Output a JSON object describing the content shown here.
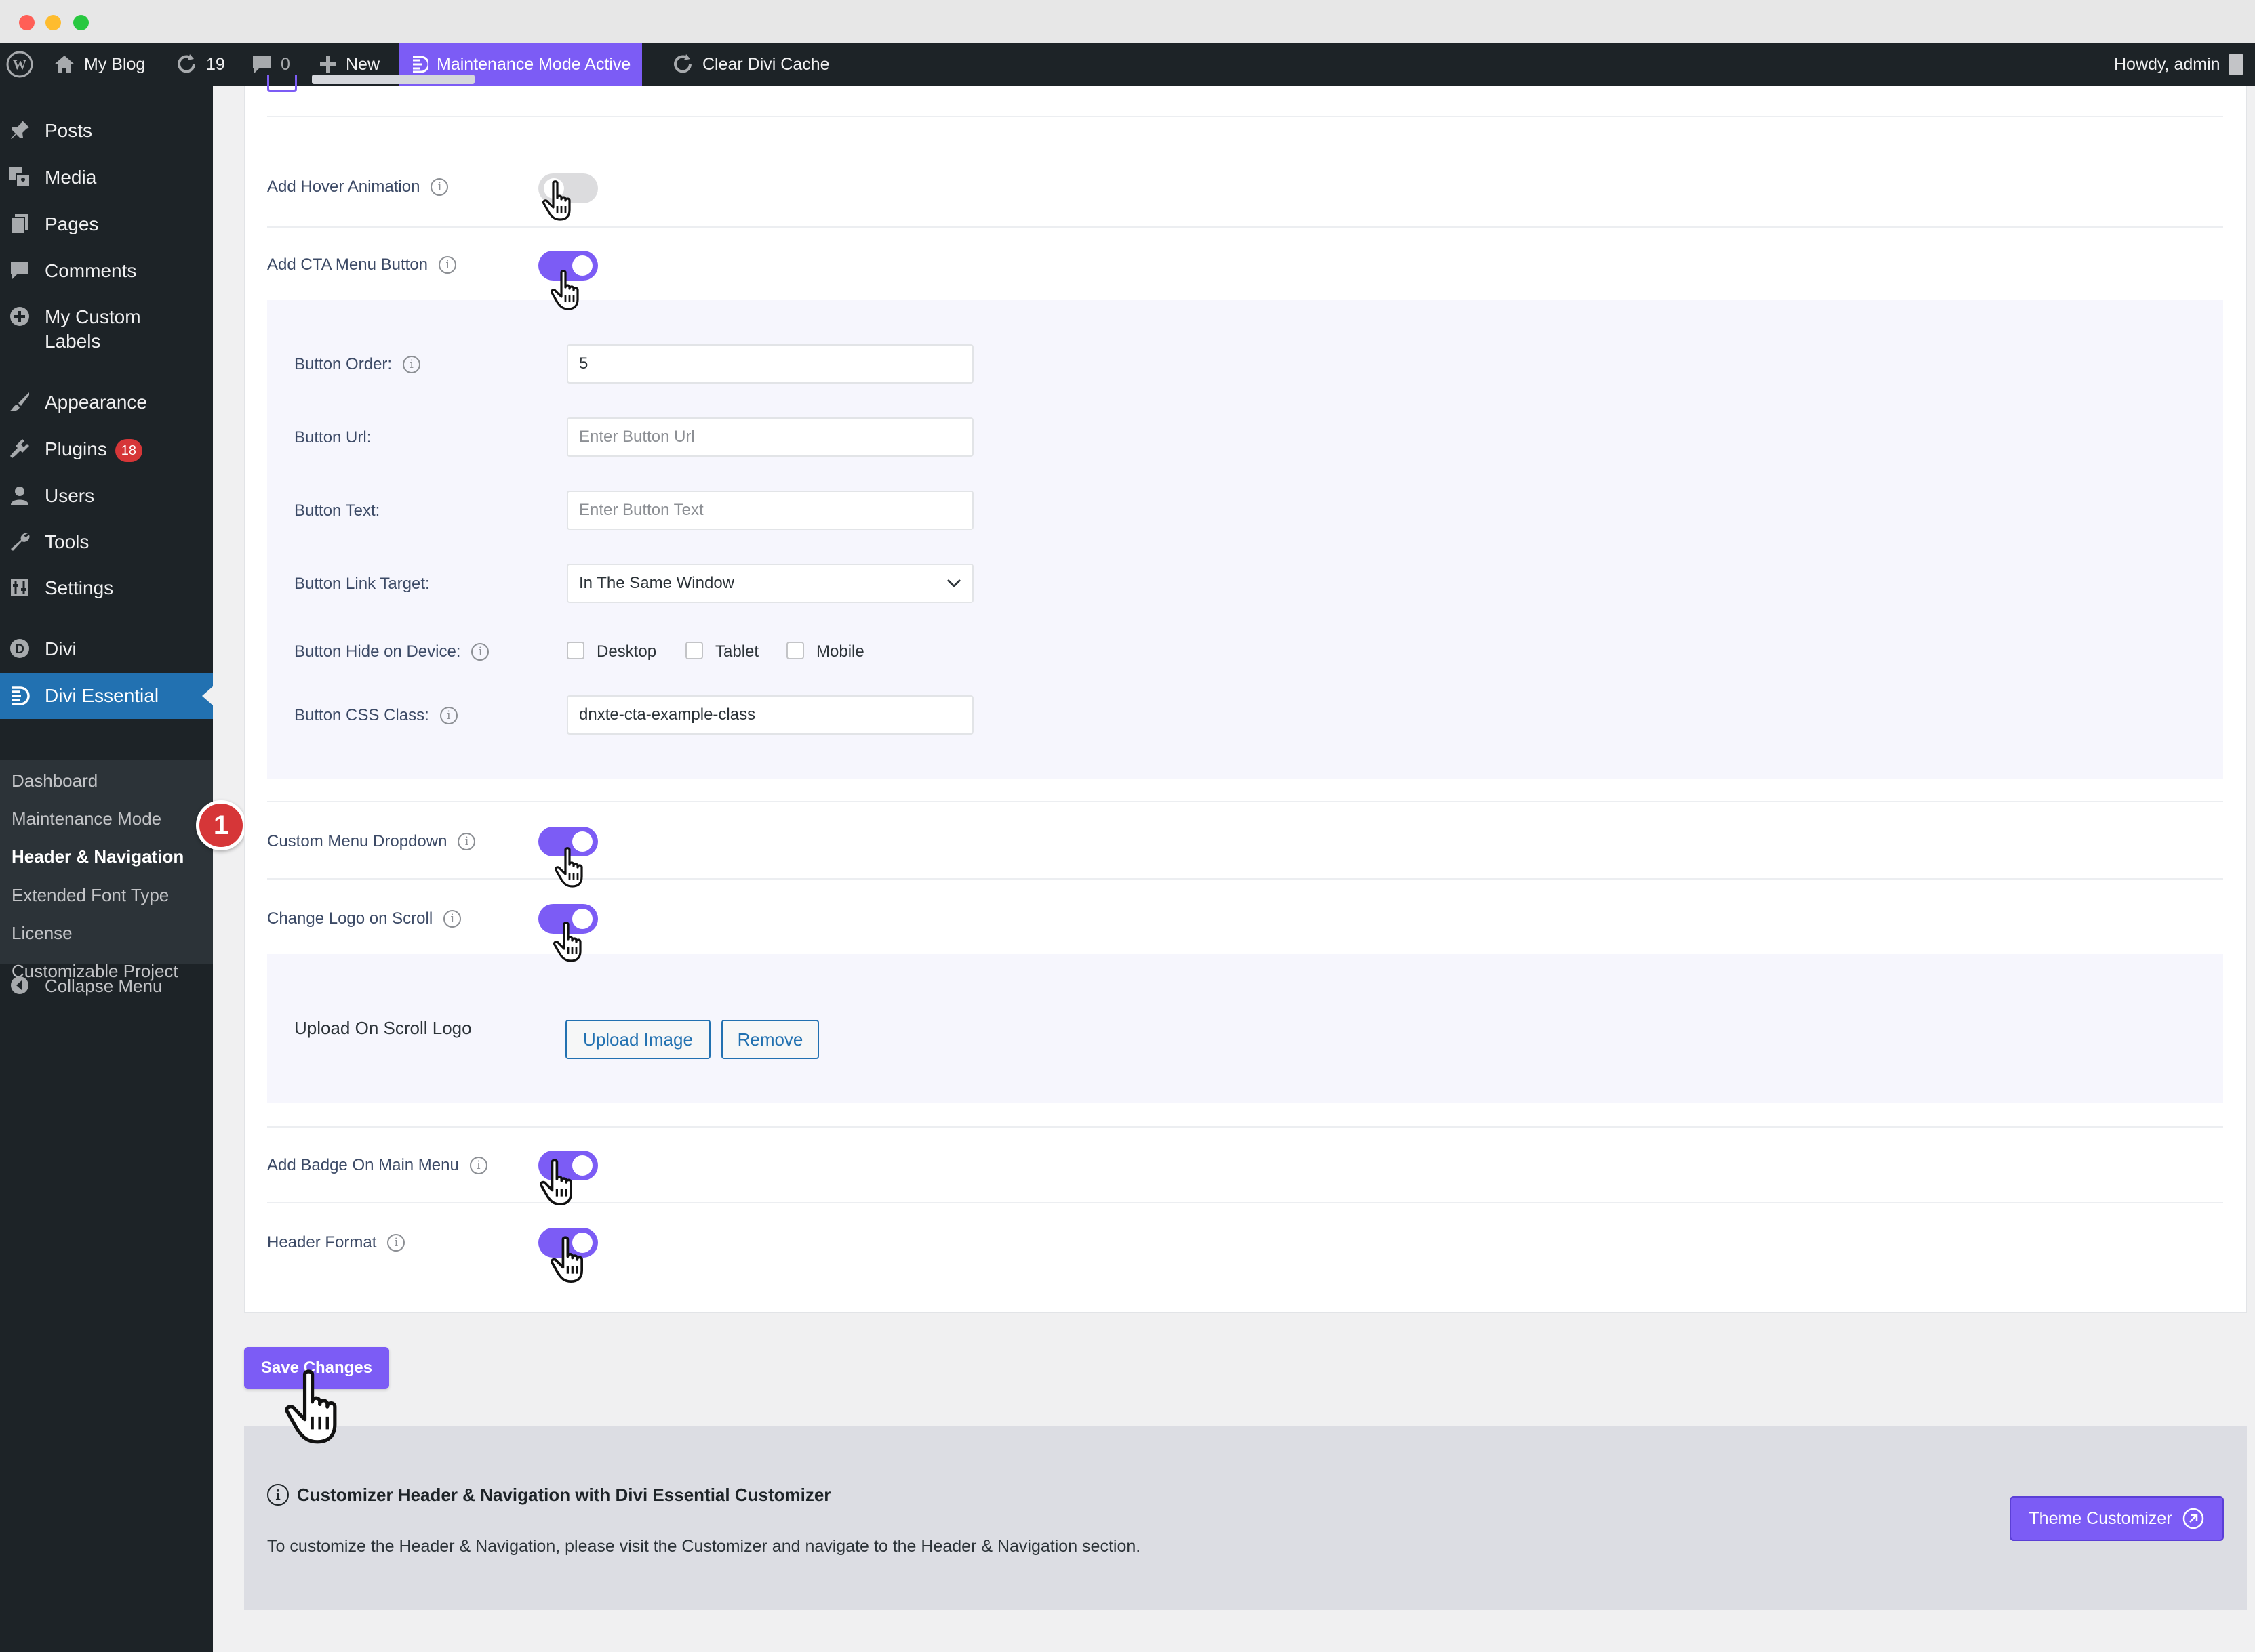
{
  "adminbar": {
    "site_name": "My Blog",
    "updates_count": "19",
    "comments_count": "0",
    "new_label": "New",
    "maintenance_label": "Maintenance Mode Active",
    "clear_cache_label": "Clear Divi Cache",
    "greeting": "Howdy, admin"
  },
  "sidebar": {
    "items": [
      {
        "label": "Posts",
        "icon": "pin-icon"
      },
      {
        "label": "Media",
        "icon": "media-icon"
      },
      {
        "label": "Pages",
        "icon": "pages-icon"
      },
      {
        "label": "Comments",
        "icon": "comment-icon"
      },
      {
        "label": "My Custom Labels",
        "icon": "plus-circle-icon"
      },
      {
        "label": "Appearance",
        "icon": "brush-icon"
      },
      {
        "label": "Plugins",
        "icon": "plugin-icon",
        "badge": "18"
      },
      {
        "label": "Users",
        "icon": "user-icon"
      },
      {
        "label": "Tools",
        "icon": "wrench-icon"
      },
      {
        "label": "Settings",
        "icon": "settings-icon"
      },
      {
        "label": "Divi",
        "icon": "divi-icon"
      },
      {
        "label": "Divi Essential",
        "icon": "divi-essential-icon"
      }
    ],
    "submenu": [
      "Dashboard",
      "Maintenance Mode",
      "Header & Navigation",
      "Extended Font Type",
      "License",
      "Customizable Project"
    ],
    "collapse_label": "Collapse Menu",
    "step_badge": "1"
  },
  "settings": {
    "hover_animation": {
      "label": "Add Hover Animation",
      "enabled": false
    },
    "cta_button": {
      "label": "Add CTA Menu Button",
      "enabled": true,
      "button_order": {
        "label": "Button Order:",
        "value": "5"
      },
      "button_url": {
        "label": "Button Url:",
        "placeholder": "Enter Button Url"
      },
      "button_text": {
        "label": "Button Text:",
        "placeholder": "Enter Button Text"
      },
      "link_target": {
        "label": "Button Link Target:",
        "value": "In The Same Window"
      },
      "hide_on_device": {
        "label": "Button Hide on Device:",
        "options": [
          "Desktop",
          "Tablet",
          "Mobile"
        ]
      },
      "css_class": {
        "label": "Button CSS Class:",
        "value": "dnxte-cta-example-class"
      }
    },
    "custom_menu_dropdown": {
      "label": "Custom Menu Dropdown",
      "enabled": true
    },
    "change_logo_on_scroll": {
      "label": "Change Logo on Scroll",
      "enabled": true,
      "upload_label": "Upload On Scroll Logo",
      "upload_button": "Upload Image",
      "remove_button": "Remove"
    },
    "badge_on_main_menu": {
      "label": "Add Badge On Main Menu",
      "enabled": true
    },
    "header_format": {
      "label": "Header Format",
      "enabled": true
    }
  },
  "save_button": "Save Changes",
  "notice": {
    "title": "Customizer Header & Navigation with Divi Essential Customizer",
    "text": "To customize the Header & Navigation, please visit the Customizer and navigate to the Header & Navigation section.",
    "button": "Theme Customizer"
  },
  "colors": {
    "accent": "#7c5cf5",
    "wp_blue": "#2271b1",
    "sidebar_bg": "#1d2327",
    "badge_red": "#d63638"
  }
}
